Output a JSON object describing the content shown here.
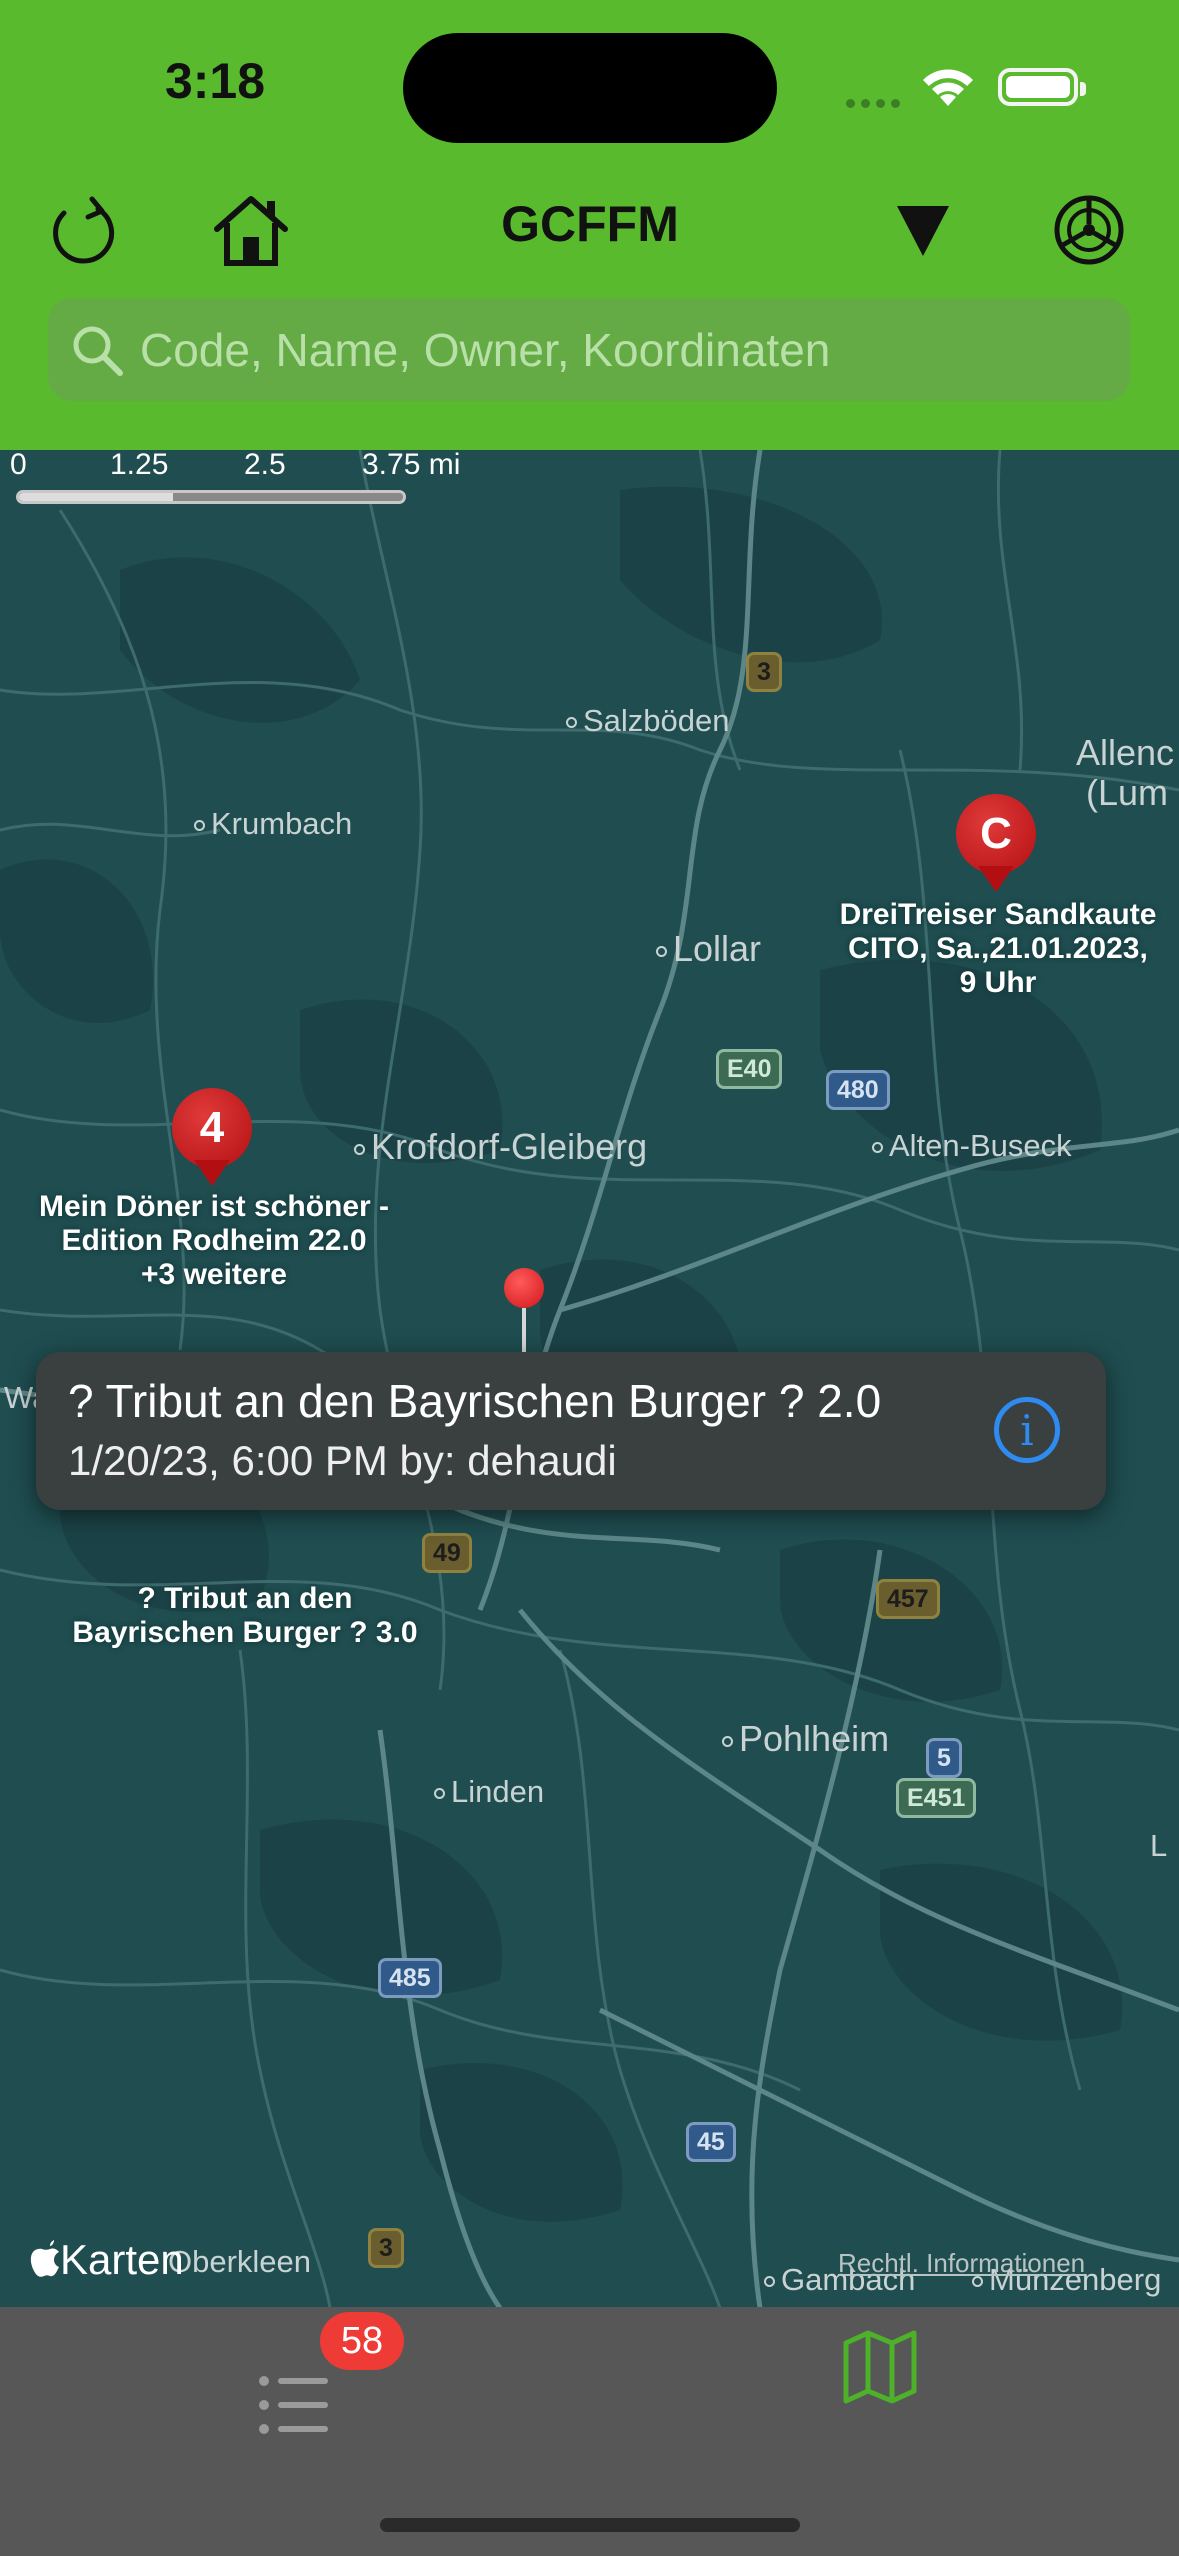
{
  "status": {
    "time": "3:18"
  },
  "header": {
    "title": "GCFFM",
    "search_placeholder": "Code, Name, Owner, Koordinaten"
  },
  "map": {
    "scale_labels": [
      "0",
      "1.25",
      "2.5",
      "3.75 mi"
    ],
    "places": {
      "salzboeden": "Salzböden",
      "krumbach": "Krumbach",
      "lollar": "Lollar",
      "krofdorf": "Krofdorf-Gleiberg",
      "alten_buseck": "Alten-Buseck",
      "allendorf_1": "Allenc",
      "allendorf_2": "(Lum",
      "pohlheim": "Pohlheim",
      "linden": "Linden",
      "gambach": "Gambach",
      "muenzenberg": "Münzenberg",
      "oberkleen": "Oberkleen",
      "wa": "Wa",
      "l": "L"
    },
    "roads": {
      "r3a": "3",
      "e40": "E40",
      "a480": "480",
      "b49": "49",
      "b457": "457",
      "a5": "5",
      "e451": "E451",
      "a485": "485",
      "a45": "45",
      "r3b": "3"
    },
    "pins": {
      "cluster_count": "4",
      "cluster_label_1": "Mein Döner ist schöner -",
      "cluster_label_2": "Edition Rodheim 22.0",
      "cluster_label_3": "+3 weitere",
      "cito_letter": "C",
      "cito_label_1": "DreiTreiser Sandkaute",
      "cito_label_2": "CITO, Sa.,21.01.2023,",
      "cito_label_3": "9 Uhr",
      "burger_label_1": "? Tribut an den",
      "burger_label_2": "Bayrischen Burger ? 3.0"
    },
    "callout": {
      "title": "? Tribut an den Bayrischen Burger ? 2.0",
      "subtitle": "1/20/23, 6:00 PM by: dehaudi"
    },
    "credit": "Karten",
    "legal": "Rechtl. Informationen"
  },
  "tabbar": {
    "list_badge": "58"
  },
  "colors": {
    "header": "#59ba2e",
    "map": "#1f4d50",
    "pin": "#c0171b",
    "tab_active": "#4db12a"
  }
}
